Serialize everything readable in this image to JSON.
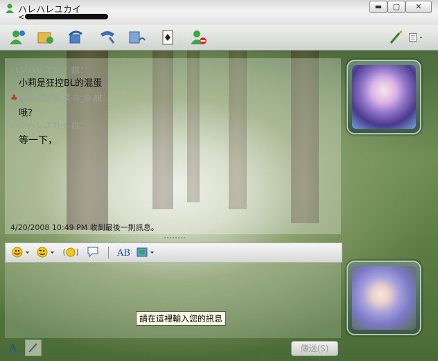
{
  "window": {
    "title": "ハレハレユカイ",
    "subtitle": "<"
  },
  "toolbar": {
    "icons": [
      "invite-contact-icon",
      "share-files-icon",
      "video-call-icon",
      "call-icon",
      "activities-icon",
      "games-icon",
      "block-icon",
      "theme-brush-icon",
      "menu-icon"
    ]
  },
  "conversation": {
    "messages": [
      {
        "sender": "ハレハレユカイ 說：",
        "text": "小莉是狂控BL的混蛋"
      },
      {
        "sender": "既高貴又溫柔 ⊙_⊙ 說：",
        "text": "哦？"
      },
      {
        "sender": "ハレハレユカイ 說：",
        "text": "等一下，"
      }
    ],
    "status": "4/20/2008 10:49 PM 收到最後一則訊息。"
  },
  "input": {
    "tooltip": "請在這裡輸入您的訊息",
    "send_label": "傳送(S)"
  },
  "colors": {
    "sender_gray": "#9aa39a",
    "titlebar": "#e8e8e8"
  }
}
